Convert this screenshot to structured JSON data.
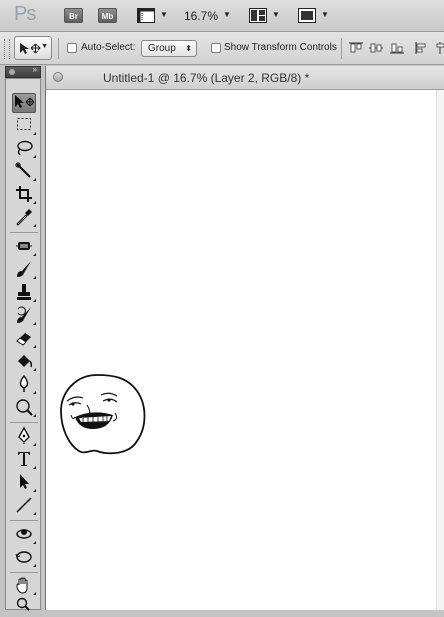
{
  "app": {
    "logo": "Ps",
    "bridge_button": "Br",
    "minibridge_button": "Mb",
    "zoom_level": "16.7%",
    "icons": [
      "view-extras-icon",
      "arrange-documents-icon",
      "screen-mode-icon"
    ]
  },
  "options": {
    "auto_select_label": "Auto-Select:",
    "auto_select_checked": false,
    "auto_select_target": "Group",
    "show_transform_controls_label": "Show Transform Controls",
    "show_transform_controls_checked": false
  },
  "document": {
    "title": "Untitled-1 @ 16.7% (Layer 2, RGB/8) *"
  },
  "tools": [
    "move-tool",
    "marquee-tool",
    "lasso-tool",
    "quick-selection-tool",
    "crop-tool",
    "eyedropper-tool",
    "healing-brush-tool",
    "brush-tool",
    "clone-stamp-tool",
    "history-brush-tool",
    "eraser-tool",
    "paint-bucket-tool",
    "blur-tool",
    "dodge-tool",
    "pen-tool",
    "type-tool",
    "path-selection-tool",
    "line-tool",
    "3d-rotate-tool",
    "3d-orbit-tool",
    "hand-tool",
    "zoom-tool"
  ],
  "active_tool": "move-tool"
}
